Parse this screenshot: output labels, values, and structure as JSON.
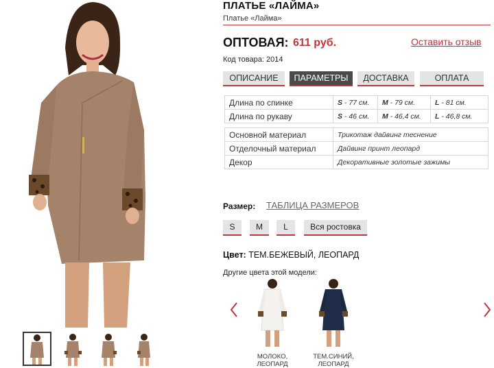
{
  "product": {
    "title": "ПЛАТЬЕ «ЛАЙМА»",
    "subtitle": "Платье «Лайма»",
    "price_label": "ОПТОВАЯ:",
    "price_value": "611 руб.",
    "review_link": "Оставить отзыв",
    "sku": "Код товара: 2014"
  },
  "tabs": [
    {
      "label": "ОПИСАНИЕ",
      "active": false
    },
    {
      "label": "ПАРАМЕТРЫ",
      "active": true
    },
    {
      "label": "ДОСТАВКА",
      "active": false
    },
    {
      "label": "ОПЛАТА",
      "active": false
    }
  ],
  "measurements": [
    {
      "label": "Длина по спинке",
      "s_size": "S",
      "s_val": " - 77 см.",
      "m_size": "M",
      "m_val": " - 79 см.",
      "l_size": "L",
      "l_val": " - 81 см."
    },
    {
      "label": "Длина по рукаву",
      "s_size": "S",
      "s_val": " - 46 см.",
      "m_size": "M",
      "m_val": " - 46,4 см.",
      "l_size": "L",
      "l_val": " - 46,8 см."
    }
  ],
  "materials": [
    {
      "label": "Основной материал",
      "value": "Трикотаж дайвинг теснение"
    },
    {
      "label": "Отделочный материал",
      "value": "Дайвинг принт леопард"
    },
    {
      "label": "Декор",
      "value": "Декоративные золотые зажимы"
    }
  ],
  "size": {
    "label": "Размер:",
    "table_link": "ТАБЛИЦА РАЗМЕРОВ",
    "options": [
      "S",
      "M",
      "L",
      "Вся ростовка"
    ]
  },
  "color": {
    "label": "Цвет:",
    "value": " ТЕМ.БЕЖЕВЫЙ, ЛЕОПАРД",
    "other_label": "Другие цвета этой модели:"
  },
  "variants": [
    {
      "caption_1": "МОЛОКО,",
      "caption_2": "ЛЕОПАРД",
      "dress_color": "#f4f2ee"
    },
    {
      "caption_1": "ТЕМ.СИНИЙ,",
      "caption_2": "ЛЕОПАРД",
      "dress_color": "#1f2d4a"
    }
  ],
  "colors": {
    "accent": "#c0343b",
    "tab_bg": "#e4e4e4",
    "tab_active_bg": "#4a4a4a",
    "dress": "#a5826a",
    "leopard": "#6a4a2a"
  },
  "icons": {
    "prev": "chevron-left-icon",
    "next": "chevron-right-icon"
  }
}
